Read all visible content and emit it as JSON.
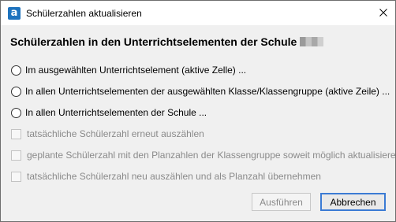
{
  "window": {
    "title": "Schülerzahlen aktualisieren",
    "app_icon_letter": "a",
    "close_glyph": "×"
  },
  "heading": "Schülerzahlen in den Unterrichtselementen der Schule",
  "radio_options": [
    {
      "label": "Im ausgewählten Unterrichtselement (aktive Zelle) ...",
      "checked": false
    },
    {
      "label": "In allen Unterrichtselementen der ausgewählten Klasse/Klassengruppe (aktive Zeile) ...",
      "checked": false
    },
    {
      "label": "In allen Unterrichtselementen der Schule ...",
      "checked": false
    }
  ],
  "checkbox_options": [
    {
      "label": "tatsächliche Schülerzahl erneut auszählen",
      "checked": false,
      "enabled": false
    },
    {
      "label": "geplante Schülerzahl mit den Planzahlen der Klassengruppe soweit möglich aktualisieren",
      "checked": false,
      "enabled": false
    },
    {
      "label": "tatsächliche Schülerzahl neu auszählen und als Planzahl übernehmen",
      "checked": false,
      "enabled": false
    }
  ],
  "buttons": {
    "run": "Ausführen",
    "cancel": "Abbrechen"
  },
  "icons": {
    "app": "app-logo-icon",
    "close": "close-icon"
  },
  "colors": {
    "app_icon": "#1e73be",
    "focus_border": "#3b7bd4",
    "disabled_text": "#8a8a8a"
  }
}
